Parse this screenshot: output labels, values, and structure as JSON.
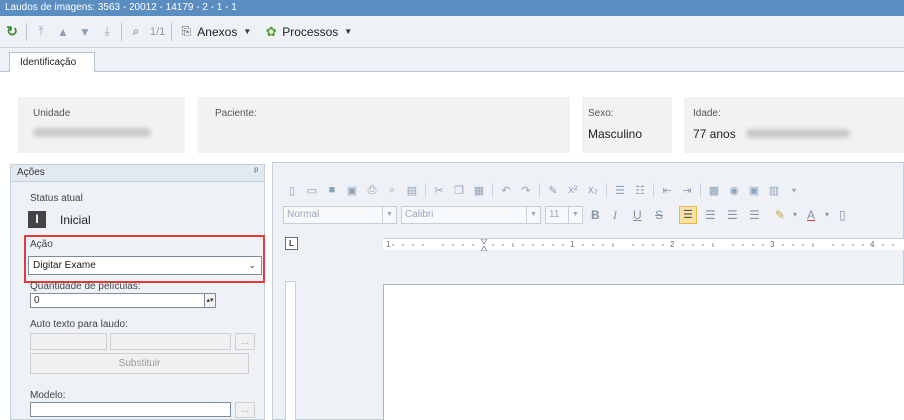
{
  "window": {
    "title": "Laudos de imagens: 3563 - 20012 - 14179 - 2 - 1 - 1"
  },
  "toolbar": {
    "record_counter": "1/1",
    "anexos_label": "Anexos",
    "processos_label": "Processos"
  },
  "tabs": [
    {
      "label": "Identificação"
    }
  ],
  "identificacao": {
    "unidade_label": "Unidade",
    "paciente_label": "Paciente:",
    "sexo_label": "Sexo:",
    "sexo_value": "Masculino",
    "idade_label": "Idade:",
    "idade_value": "77 anos"
  },
  "acoes": {
    "panel_title": "Ações",
    "status_label": "Status atual",
    "status_letter": "I",
    "status_value": "Inicial",
    "acao_label": "Ação",
    "acao_value": "Digitar Exame",
    "quantidade_label": "Quantidade de películas:",
    "quantidade_value": "0",
    "auto_texto_label": "Auto texto para laudo:",
    "ellipsis": "...",
    "substituir_label": "Substituir",
    "modelo_label": "Modelo:"
  },
  "editor": {
    "style_value": "Normal",
    "font_value": "Calibri",
    "size_value": "11",
    "ruler_corner": "L"
  },
  "colors": {
    "titlebar": "#5b8ec0",
    "highlight_border": "#e23b3b",
    "align_active": "#fbe3a6"
  }
}
